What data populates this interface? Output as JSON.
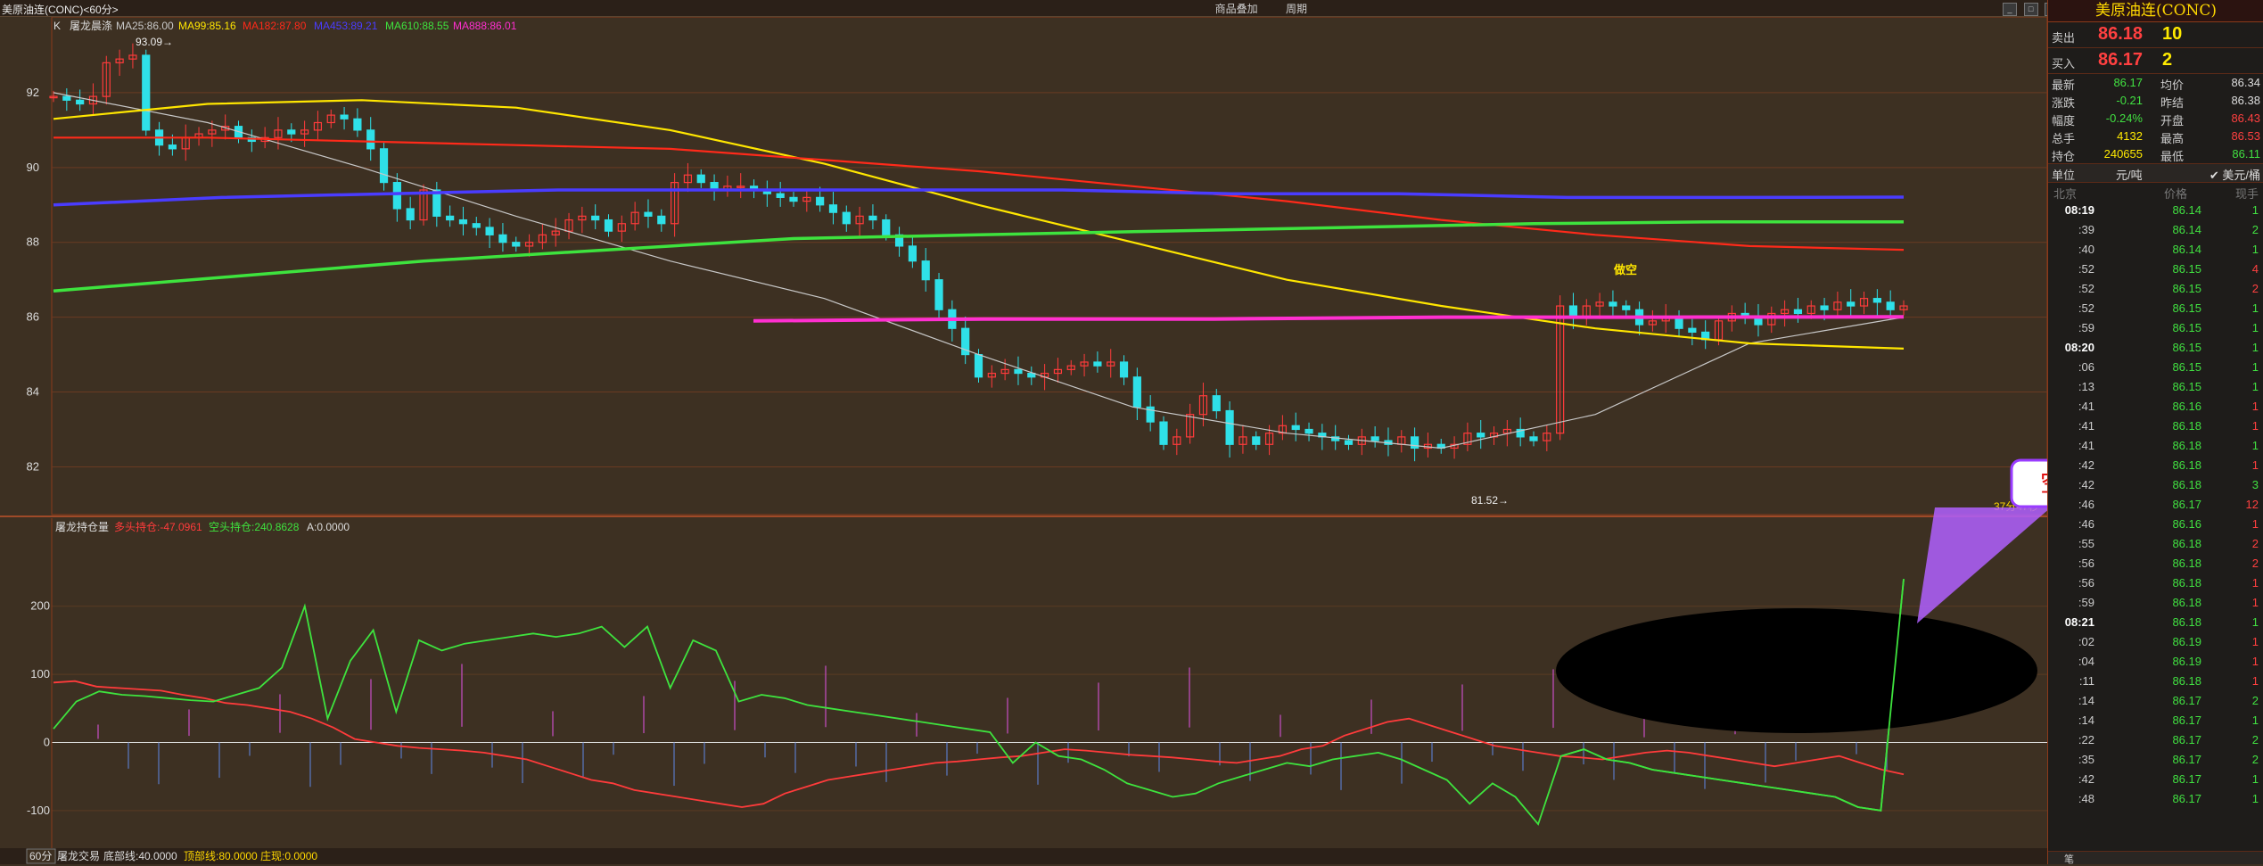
{
  "titlebar": {
    "title": "美原油连(CONC)<60分>",
    "buttons": [
      "商品叠加",
      "周期"
    ],
    "window_controls": [
      "_",
      "□",
      "×"
    ]
  },
  "kline": {
    "legend": {
      "prefix": "K",
      "name": "屠龙晨涤",
      "ma25": "MA25:86.00",
      "ma99": "MA99:85.16",
      "ma182": "MA182:87.80",
      "ma453": "MA453:89.21",
      "ma610": "MA610:88.55",
      "ma888": "MA888:86.01"
    },
    "ytick_labels": [
      "92",
      "90",
      "88",
      "86",
      "84",
      "82"
    ],
    "high_label": "93.09→",
    "low_label": "81.52→",
    "signal_label": "做空",
    "countdown": "37分47秒"
  },
  "indicator": {
    "legend": {
      "name": "屠龙持仓量",
      "long": "多头持仓:-47.0961",
      "short": "空头持仓:240.8628",
      "a": "A:0.0000"
    },
    "ytick_labels": [
      "200",
      "100",
      "0",
      "-100"
    ],
    "callout": "空头主力占优"
  },
  "bottom_bar": {
    "period": "60分",
    "name": "屠龙交易",
    "bottom": "底部线:40.0000",
    "top": "顶部线:80.0000",
    "zhuang": "庄现:0.0000"
  },
  "colors": {
    "bg": "#3d3022",
    "up": "#ff3b3b",
    "down": "#2fe0e8",
    "ma25": "#c8c8c8",
    "ma99": "#ffe600",
    "ma182": "#ff2a1a",
    "ma453": "#4a3cff",
    "ma610": "#3ee33e",
    "ma888": "#ff2fd0",
    "accent": "#ffd800"
  },
  "chart_data": [
    {
      "type": "candlestick",
      "title": "美原油连(CONC) 60分",
      "ylim": [
        81.2,
        93.5
      ],
      "series": [
        {
          "name": "MA25",
          "values": [
            92.0,
            91.2,
            90.0,
            88.7,
            87.5,
            86.5,
            85.0,
            83.6,
            82.9,
            82.5,
            83.4,
            85.3,
            86.0
          ]
        },
        {
          "name": "MA99",
          "values": [
            91.3,
            91.7,
            91.8,
            91.6,
            91.0,
            90.1,
            89.0,
            88.0,
            87.0,
            86.3,
            85.7,
            85.3,
            85.16
          ]
        },
        {
          "name": "MA182",
          "values": [
            90.8,
            90.8,
            90.7,
            90.6,
            90.5,
            90.2,
            89.9,
            89.5,
            89.1,
            88.6,
            88.2,
            87.9,
            87.8
          ]
        },
        {
          "name": "MA453",
          "values": [
            89.0,
            89.2,
            89.3,
            89.4,
            89.4,
            89.4,
            89.4,
            89.3,
            89.3,
            89.2,
            89.2,
            89.21
          ]
        },
        {
          "name": "MA610",
          "values": [
            86.7,
            87.1,
            87.5,
            87.8,
            88.1,
            88.2,
            88.3,
            88.4,
            88.5,
            88.55,
            88.55
          ]
        },
        {
          "name": "MA888",
          "values": [
            85.9,
            85.95,
            85.95,
            86.0,
            86.0,
            86.01
          ]
        }
      ],
      "close": [
        91.9,
        91.8,
        91.7,
        91.9,
        92.8,
        92.9,
        93.0,
        91.0,
        90.6,
        90.5,
        90.8,
        90.9,
        91.0,
        91.1,
        90.8,
        90.7,
        90.8,
        91.0,
        90.9,
        91.0,
        91.2,
        91.4,
        91.3,
        91.0,
        90.5,
        89.6,
        88.9,
        88.6,
        89.4,
        88.7,
        88.6,
        88.5,
        88.4,
        88.2,
        88.0,
        87.9,
        88.0,
        88.2,
        88.3,
        88.6,
        88.7,
        88.6,
        88.3,
        88.5,
        88.8,
        88.7,
        88.5,
        89.6,
        89.8,
        89.6,
        89.4,
        89.5,
        89.5,
        89.4,
        89.3,
        89.2,
        89.1,
        89.2,
        89.0,
        88.8,
        88.5,
        88.7,
        88.6,
        88.2,
        87.9,
        87.5,
        87.0,
        86.2,
        85.7,
        85.0,
        84.4,
        84.5,
        84.6,
        84.5,
        84.4,
        84.5,
        84.6,
        84.7,
        84.8,
        84.7,
        84.8,
        84.4,
        83.6,
        83.2,
        82.6,
        82.8,
        83.4,
        83.9,
        83.5,
        82.6,
        82.8,
        82.6,
        82.9,
        83.1,
        83.0,
        82.9,
        82.8,
        82.7,
        82.6,
        82.8,
        82.7,
        82.6,
        82.8,
        82.5,
        82.6,
        82.5,
        82.6,
        82.9,
        82.8,
        82.9,
        83.0,
        82.8,
        82.7,
        82.9,
        86.3,
        86.0,
        86.3,
        86.4,
        86.3,
        86.2,
        85.8,
        85.9,
        86.0,
        85.7,
        85.6,
        85.4,
        85.9,
        86.1,
        86.0,
        85.8,
        86.1,
        86.2,
        86.1,
        86.3,
        86.2,
        86.4,
        86.3,
        86.5,
        86.4,
        86.2,
        86.3
      ]
    },
    {
      "type": "line",
      "title": "屠龙持仓量",
      "ylim": [
        -150,
        290
      ],
      "series": [
        {
          "name": "多头持仓",
          "values": [
            88,
            90,
            82,
            80,
            78,
            76,
            70,
            65,
            58,
            55,
            50,
            45,
            35,
            22,
            5,
            0,
            -5,
            -8,
            -10,
            -12,
            -15,
            -20,
            -25,
            -35,
            -45,
            -55,
            -60,
            -70,
            -75,
            -80,
            -85,
            -90,
            -95,
            -90,
            -75,
            -65,
            -55,
            -50,
            -45,
            -40,
            -35,
            -30,
            -28,
            -25,
            -22,
            -20,
            -15,
            -10,
            -12,
            -15,
            -18,
            -20,
            -22,
            -25,
            -28,
            -30,
            -25,
            -20,
            -10,
            -5,
            10,
            20,
            30,
            35,
            25,
            15,
            5,
            -5,
            -10,
            -15,
            -20,
            -22,
            -25,
            -20,
            -15,
            -12,
            -15,
            -20,
            -25,
            -30,
            -35,
            -30,
            -25,
            -20,
            -30,
            -40,
            -47
          ]
        },
        {
          "name": "空头持仓",
          "values": [
            20,
            60,
            75,
            70,
            68,
            65,
            62,
            60,
            70,
            80,
            110,
            200,
            35,
            120,
            165,
            45,
            150,
            135,
            145,
            150,
            155,
            160,
            155,
            160,
            170,
            140,
            170,
            80,
            150,
            135,
            60,
            70,
            65,
            55,
            50,
            45,
            40,
            35,
            30,
            25,
            20,
            15,
            -30,
            0,
            -20,
            -25,
            -40,
            -60,
            -70,
            -80,
            -75,
            -60,
            -50,
            -40,
            -30,
            -35,
            -25,
            -20,
            -15,
            -25,
            -40,
            -55,
            -90,
            -60,
            -80,
            -120,
            -20,
            -10,
            -25,
            -30,
            -40,
            -45,
            -50,
            -55,
            -60,
            -65,
            -70,
            -75,
            -80,
            -95,
            -100,
            240
          ]
        }
      ]
    }
  ],
  "right_panel": {
    "title": "美原油连(CONC)",
    "ask": {
      "label": "卖出",
      "price": "86.18",
      "volume": "10"
    },
    "bid": {
      "label": "买入",
      "price": "86.17",
      "volume": "2"
    },
    "stats": [
      {
        "l1": "最新",
        "v1": "86.17",
        "c1": "g",
        "l2": "均价",
        "v2": "86.34",
        "c2": "w"
      },
      {
        "l1": "涨跌",
        "v1": "-0.21",
        "c1": "g",
        "l2": "昨结",
        "v2": "86.38",
        "c2": "w"
      },
      {
        "l1": "幅度",
        "v1": "-0.24%",
        "c1": "g",
        "l2": "开盘",
        "v2": "86.43",
        "c2": "r"
      },
      {
        "l1": "总手",
        "v1": "4132",
        "c1": "y",
        "l2": "最高",
        "v2": "86.53",
        "c2": "r"
      },
      {
        "l1": "持仓",
        "v1": "240655",
        "c1": "y",
        "l2": "最低",
        "v2": "86.11",
        "c2": "g"
      }
    ],
    "unit": {
      "label": "单位",
      "value": "元/吨",
      "check": "美元/桶"
    },
    "table_header": {
      "time": "北京",
      "price": "价格",
      "volume": "现手"
    },
    "ticks": [
      {
        "t": "08:19",
        "p": "86.14",
        "v": "1",
        "pc": "g",
        "vc": "g",
        "bold": true
      },
      {
        "t": ":39",
        "p": "86.14",
        "v": "2",
        "pc": "g",
        "vc": "g"
      },
      {
        "t": ":40",
        "p": "86.14",
        "v": "1",
        "pc": "g",
        "vc": "g"
      },
      {
        "t": ":52",
        "p": "86.15",
        "v": "4",
        "pc": "g",
        "vc": "r"
      },
      {
        "t": ":52",
        "p": "86.15",
        "v": "2",
        "pc": "g",
        "vc": "r"
      },
      {
        "t": ":52",
        "p": "86.15",
        "v": "1",
        "pc": "g",
        "vc": "g"
      },
      {
        "t": ":59",
        "p": "86.15",
        "v": "1",
        "pc": "g",
        "vc": "g"
      },
      {
        "t": "08:20",
        "p": "86.15",
        "v": "1",
        "pc": "g",
        "vc": "g",
        "bold": true
      },
      {
        "t": ":06",
        "p": "86.15",
        "v": "1",
        "pc": "g",
        "vc": "g"
      },
      {
        "t": ":13",
        "p": "86.15",
        "v": "1",
        "pc": "g",
        "vc": "g"
      },
      {
        "t": ":41",
        "p": "86.16",
        "v": "1",
        "pc": "g",
        "vc": "r"
      },
      {
        "t": ":41",
        "p": "86.18",
        "v": "1",
        "pc": "g",
        "vc": "r"
      },
      {
        "t": ":41",
        "p": "86.18",
        "v": "1",
        "pc": "g",
        "vc": "g"
      },
      {
        "t": ":42",
        "p": "86.18",
        "v": "1",
        "pc": "g",
        "vc": "r"
      },
      {
        "t": ":42",
        "p": "86.18",
        "v": "3",
        "pc": "g",
        "vc": "g"
      },
      {
        "t": ":46",
        "p": "86.17",
        "v": "12",
        "pc": "g",
        "vc": "r"
      },
      {
        "t": ":46",
        "p": "86.16",
        "v": "1",
        "pc": "g",
        "vc": "r"
      },
      {
        "t": ":55",
        "p": "86.18",
        "v": "2",
        "pc": "g",
        "vc": "r"
      },
      {
        "t": ":56",
        "p": "86.18",
        "v": "2",
        "pc": "g",
        "vc": "r"
      },
      {
        "t": ":56",
        "p": "86.18",
        "v": "1",
        "pc": "g",
        "vc": "r"
      },
      {
        "t": ":59",
        "p": "86.18",
        "v": "1",
        "pc": "g",
        "vc": "r"
      },
      {
        "t": "08:21",
        "p": "86.18",
        "v": "1",
        "pc": "g",
        "vc": "g",
        "bold": true
      },
      {
        "t": ":02",
        "p": "86.19",
        "v": "1",
        "pc": "g",
        "vc": "r"
      },
      {
        "t": ":04",
        "p": "86.19",
        "v": "1",
        "pc": "g",
        "vc": "r"
      },
      {
        "t": ":11",
        "p": "86.18",
        "v": "1",
        "pc": "g",
        "vc": "r"
      },
      {
        "t": ":14",
        "p": "86.17",
        "v": "2",
        "pc": "g",
        "vc": "g"
      },
      {
        "t": ":14",
        "p": "86.17",
        "v": "1",
        "pc": "g",
        "vc": "g"
      },
      {
        "t": ":22",
        "p": "86.17",
        "v": "2",
        "pc": "g",
        "vc": "g"
      },
      {
        "t": ":35",
        "p": "86.17",
        "v": "2",
        "pc": "g",
        "vc": "g"
      },
      {
        "t": ":42",
        "p": "86.17",
        "v": "1",
        "pc": "g",
        "vc": "g"
      },
      {
        "t": ":48",
        "p": "86.17",
        "v": "1",
        "pc": "g",
        "vc": "g"
      }
    ],
    "footer_tab": "笔"
  }
}
